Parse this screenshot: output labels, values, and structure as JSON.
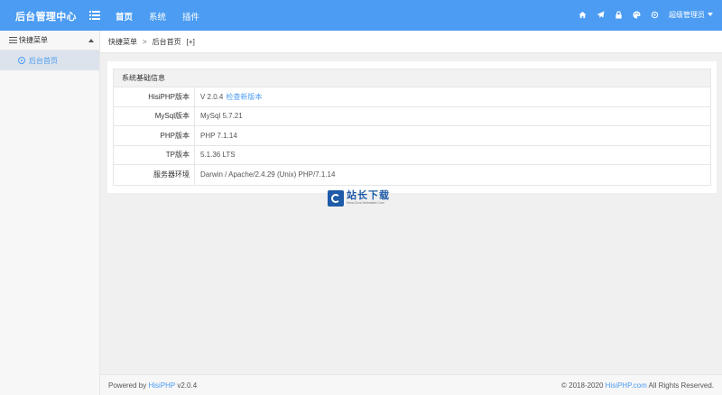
{
  "header": {
    "brand": "后台管理中心",
    "nav": [
      "首页",
      "系统",
      "插件"
    ],
    "tool_icons": [
      "home-icon",
      "paper-plane-icon",
      "lock-icon",
      "palette-icon",
      "settings-icon"
    ],
    "admin_label": "超级管理员",
    "colors": {
      "bar": "#4b9cf2"
    }
  },
  "sidebar": {
    "section_label": "快捷菜单",
    "items": [
      {
        "label": "后台首页",
        "icon": "gear-icon"
      }
    ]
  },
  "breadcrumb": {
    "root": "快捷菜单",
    "separator": ">",
    "current": "后台首页",
    "add": "[+]"
  },
  "info": {
    "title": "系统基础信息",
    "rows": [
      {
        "key": "HisiPHP版本",
        "value": "V 2.0.4",
        "link": "检查新版本"
      },
      {
        "key": "MySql版本",
        "value": "MySql 5.7.21"
      },
      {
        "key": "PHP版本",
        "value": "PHP 7.1.14"
      },
      {
        "key": "TP版本",
        "value": "5.1.36 LTS"
      },
      {
        "key": "服务器环境",
        "value": "Darwin / Apache/2.4.29 (Unix) PHP/7.1.14"
      }
    ]
  },
  "watermark": {
    "cn": "站长下载",
    "en": "Www.Zzxz.Netmaster.Com"
  },
  "footer": {
    "powered_prefix": "Powered by",
    "powered_link": "HisiPHP",
    "version": "v2.0.4",
    "copyright_prefix": "© 2018-2020",
    "copyright_link": "HisiPHP.com",
    "copyright_suffix": "All Rights Reserved."
  }
}
